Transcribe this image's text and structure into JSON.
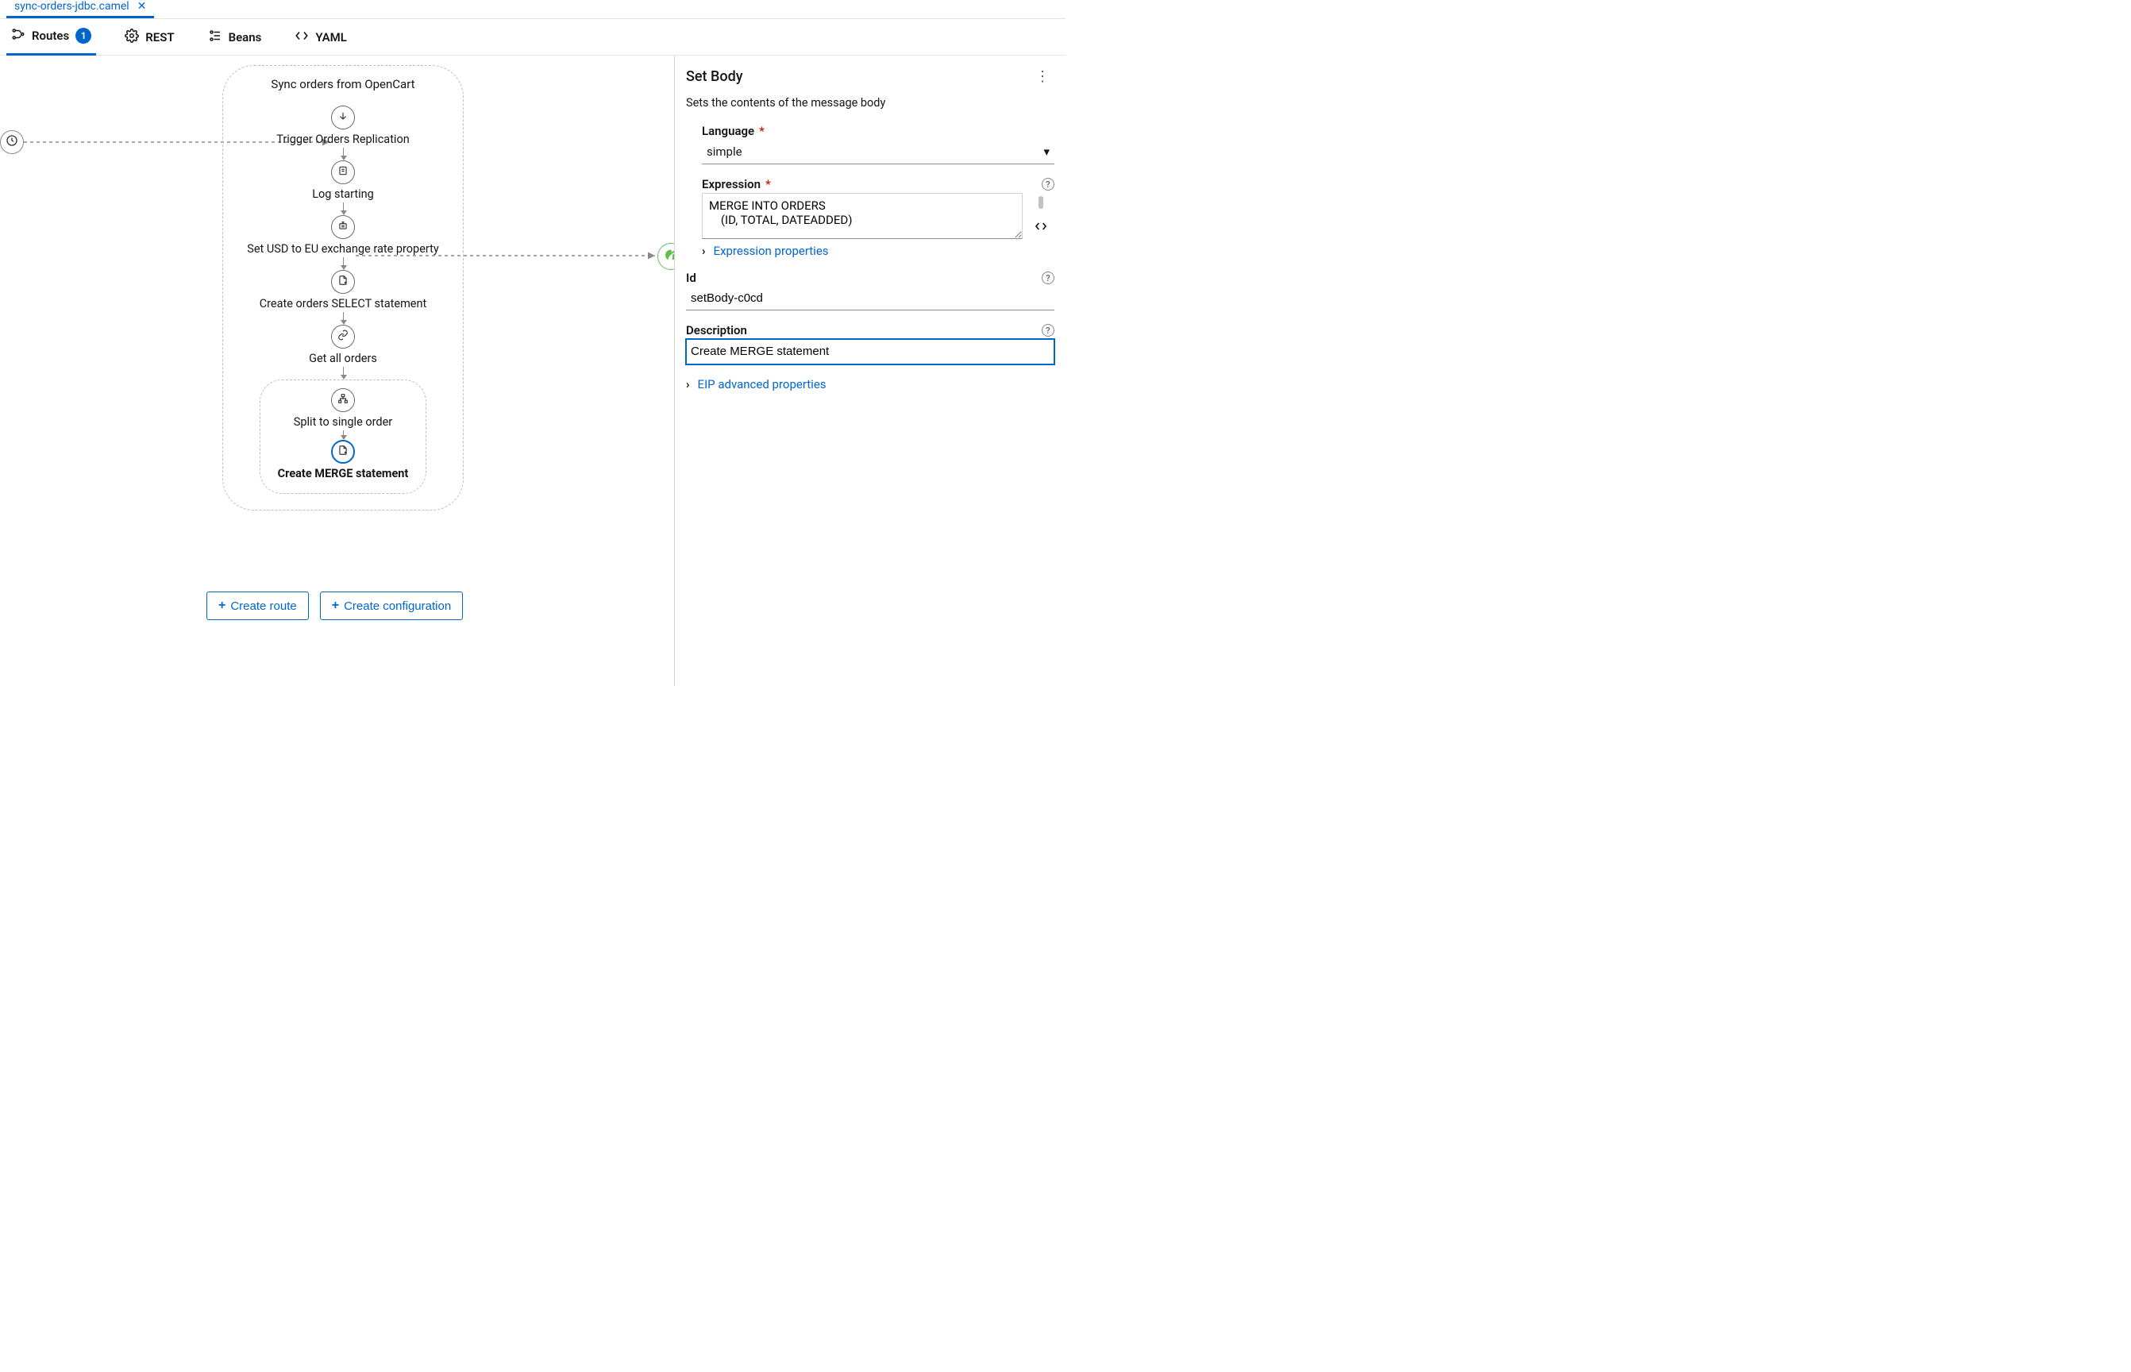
{
  "file_tab": {
    "name": "sync-orders-jdbc.camel"
  },
  "subtabs": {
    "routes": {
      "label": "Routes",
      "badge": "1"
    },
    "rest": {
      "label": "REST"
    },
    "beans": {
      "label": "Beans"
    },
    "yaml": {
      "label": "YAML"
    }
  },
  "route": {
    "title": "Sync orders from OpenCart",
    "steps": [
      {
        "label": "Trigger Orders Replication",
        "icon": "arrow-down"
      },
      {
        "label": "Log starting",
        "icon": "log"
      },
      {
        "label": "Set USD to EU exchange rate property",
        "icon": "set-prop"
      },
      {
        "label": "Create orders SELECT statement",
        "icon": "file-plus"
      },
      {
        "label": "Get all orders",
        "icon": "link"
      }
    ],
    "split": {
      "label": "Split to single order",
      "child": {
        "label": "Create MERGE statement",
        "icon": "file-plus",
        "selected": true
      }
    }
  },
  "buttons": {
    "create_route": "Create route",
    "create_config": "Create configuration"
  },
  "props": {
    "title": "Set Body",
    "description": "Sets the contents of the message body",
    "language_label": "Language",
    "language_value": "simple",
    "expression_label": "Expression",
    "expression_value": "MERGE INTO ORDERS\n    (ID, TOTAL, DATEADDED)",
    "expression_props_link": "Expression properties",
    "id_label": "Id",
    "id_value": "setBody-c0cd",
    "description_label": "Description",
    "description_value": "Create MERGE statement",
    "eip_link": "EIP advanced properties"
  }
}
